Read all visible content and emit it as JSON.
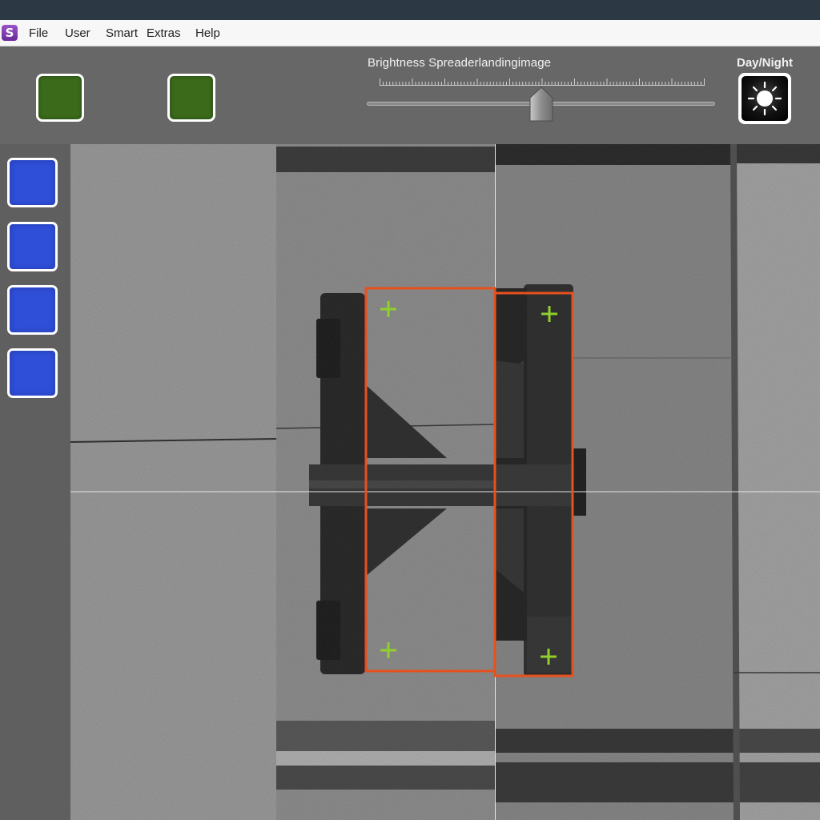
{
  "menu": {
    "logo_letter": "S",
    "items": [
      "File",
      "User",
      "Smart",
      "Extras",
      "Help"
    ]
  },
  "toolbar": {
    "green_buttons_color": "#3b6b1a",
    "slider_label": "Brightness Spreaderlandingimage",
    "slider_value_fraction": 0.5,
    "daynight_label": "Day/Night",
    "daynight_icon": "sun-icon"
  },
  "side_panel": {
    "blue_buttons_color": "#2f4fd8",
    "button_count": 4
  },
  "camera": {
    "overlay_box_color": "#e8501e",
    "marker_color": "#8fd02a",
    "marker_icon": "crosshair-plus-icon"
  }
}
